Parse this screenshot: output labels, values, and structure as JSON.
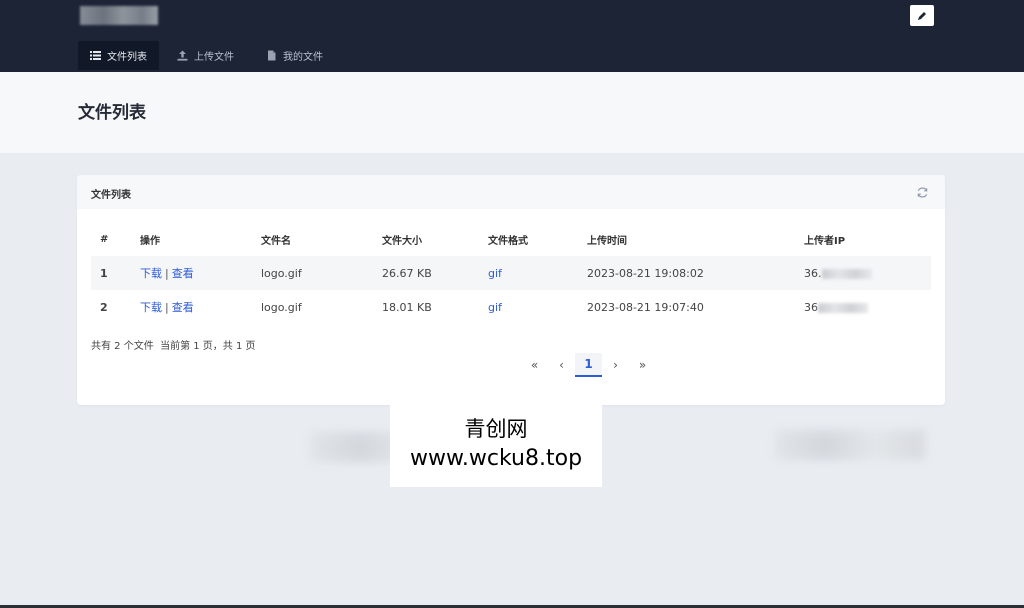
{
  "navbar": {
    "tabs": [
      {
        "label": "文件列表",
        "icon": "list-icon",
        "active": true
      },
      {
        "label": "上传文件",
        "icon": "upload-icon",
        "active": false
      },
      {
        "label": "我的文件",
        "icon": "file-icon",
        "active": false
      }
    ],
    "edit_icon": "pencil-icon"
  },
  "page": {
    "title": "文件列表"
  },
  "card": {
    "title": "文件列表",
    "refresh_icon": "refresh-icon",
    "columns": [
      "#",
      "操作",
      "文件名",
      "文件大小",
      "文件格式",
      "上传时间",
      "上传者IP"
    ],
    "rows": [
      {
        "index": "1",
        "download": "下载",
        "separator": "|",
        "view": "查看",
        "name": "logo.gif",
        "size": "26.67 KB",
        "format": "gif",
        "time": "2023-08-21 19:08:02",
        "ip": "36."
      },
      {
        "index": "2",
        "download": "下载",
        "separator": "|",
        "view": "查看",
        "name": "logo.gif",
        "size": "18.01 KB",
        "format": "gif",
        "time": "2023-08-21 19:07:40",
        "ip": "36"
      }
    ],
    "summary": "共有 2 个文件  当前第 1 页，共 1 页",
    "pager": {
      "first": "«",
      "prev": "‹",
      "current": "1",
      "next": "›",
      "last": "»"
    }
  },
  "watermark": {
    "line1": "青创网",
    "line2": "www.wcku8.top"
  },
  "colors": {
    "navbar": "#1c2436",
    "accent": "#2e5bd6",
    "background": "#e9edf2"
  }
}
